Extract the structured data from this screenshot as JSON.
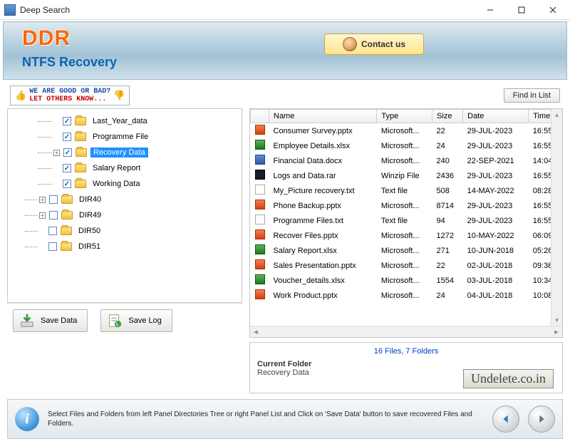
{
  "window": {
    "title": "Deep Search"
  },
  "header": {
    "brand": "DDR",
    "subtitle": "NTFS Recovery",
    "contact_label": "Contact us"
  },
  "promo": {
    "line1": "WE ARE GOOD OR BAD?",
    "line2": "LET OTHERS KNOW..."
  },
  "buttons": {
    "find_in_list": "Find in List",
    "save_data": "Save Data",
    "save_log": "Save Log"
  },
  "tree": {
    "items": [
      {
        "label": "Last_Year_data",
        "checked": true,
        "depth": 1
      },
      {
        "label": "Programme File",
        "checked": true,
        "depth": 1
      },
      {
        "label": "Recovery Data",
        "checked": true,
        "depth": 1,
        "expandable": true,
        "selected": true
      },
      {
        "label": "Salary Report",
        "checked": true,
        "depth": 1
      },
      {
        "label": "Working Data",
        "checked": true,
        "depth": 1
      },
      {
        "label": "DIR40",
        "checked": false,
        "depth": 0,
        "expandable": true
      },
      {
        "label": "DIR49",
        "checked": false,
        "depth": 0,
        "expandable": true
      },
      {
        "label": "DIR50",
        "checked": false,
        "depth": 0
      },
      {
        "label": "DIR51",
        "checked": false,
        "depth": 0
      }
    ]
  },
  "columns": {
    "name": "Name",
    "type": "Type",
    "size": "Size",
    "date": "Date",
    "time": "Time"
  },
  "files": [
    {
      "name": "Consumer Survey.pptx",
      "type": "Microsoft...",
      "size": "22",
      "date": "29-JUL-2023",
      "time": "16:55",
      "ic": "pptx"
    },
    {
      "name": "Employee Details.xlsx",
      "type": "Microsoft...",
      "size": "24",
      "date": "29-JUL-2023",
      "time": "16:55",
      "ic": "xlsx"
    },
    {
      "name": "Financial Data.docx",
      "type": "Microsoft...",
      "size": "240",
      "date": "22-SEP-2021",
      "time": "14:04",
      "ic": "docx"
    },
    {
      "name": "Logs and Data.rar",
      "type": "Winzip File",
      "size": "2436",
      "date": "29-JUL-2023",
      "time": "16:55",
      "ic": "rar"
    },
    {
      "name": "My_Picture recovery.txt",
      "type": "Text file",
      "size": "508",
      "date": "14-MAY-2022",
      "time": "08:28",
      "ic": "txt"
    },
    {
      "name": "Phone Backup.pptx",
      "type": "Microsoft...",
      "size": "8714",
      "date": "29-JUL-2023",
      "time": "16:55",
      "ic": "pptx"
    },
    {
      "name": "Programme Files.txt",
      "type": "Text file",
      "size": "94",
      "date": "29-JUL-2023",
      "time": "16:55",
      "ic": "txt"
    },
    {
      "name": "Recover Files.pptx",
      "type": "Microsoft...",
      "size": "1272",
      "date": "10-MAY-2022",
      "time": "06:09",
      "ic": "pptx"
    },
    {
      "name": "Salary Report.xlsx",
      "type": "Microsoft...",
      "size": "271",
      "date": "10-JUN-2018",
      "time": "05:26",
      "ic": "xlsx"
    },
    {
      "name": "Sales Presentation.pptx",
      "type": "Microsoft...",
      "size": "22",
      "date": "02-JUL-2018",
      "time": "09:36",
      "ic": "pptx"
    },
    {
      "name": "Voucher_details.xlsx",
      "type": "Microsoft...",
      "size": "1554",
      "date": "03-JUL-2018",
      "time": "10:34",
      "ic": "xlsx"
    },
    {
      "name": "Work Product.pptx",
      "type": "Microsoft...",
      "size": "24",
      "date": "04-JUL-2018",
      "time": "10:08",
      "ic": "pptx"
    }
  ],
  "summary": {
    "counts": "16 Files, 7 Folders",
    "current_folder_label": "Current Folder",
    "current_folder_value": "Recovery Data"
  },
  "watermark": "Undelete.co.in",
  "footer": {
    "message": "Select Files and Folders from left Panel Directories Tree or right Panel List and Click on 'Save Data' button to save recovered Files and Folders."
  }
}
